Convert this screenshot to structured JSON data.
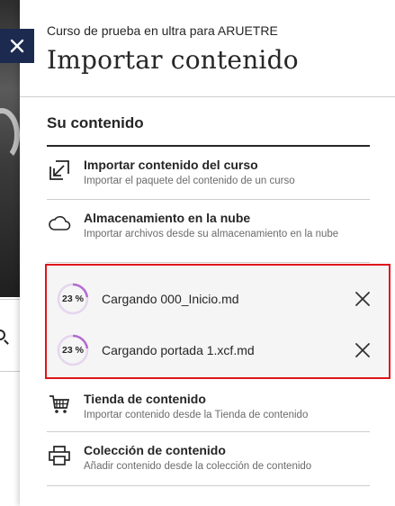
{
  "header": {
    "course_name": "Curso de prueba en ultra para ARUETRE",
    "title": "Importar contenido"
  },
  "section_title": "Su contenido",
  "items_top": [
    {
      "icon": "import-arrow-icon",
      "title": "Importar contenido del curso",
      "description": "Importar el paquete del contenido de un curso"
    },
    {
      "icon": "cloud-icon",
      "title": "Almacenamiento en la nube",
      "description": "Importar archivos desde su almacenamiento en la nube"
    }
  ],
  "uploads": [
    {
      "percent": "23 %",
      "progress": 0.23,
      "label": "Cargando 000_Inicio.md"
    },
    {
      "percent": "23 %",
      "progress": 0.23,
      "label": "Cargando portada 1.xcf.md"
    }
  ],
  "items_bottom": [
    {
      "icon": "cart-icon",
      "title": "Tienda de contenido",
      "description": "Importar contenido desde la Tienda de contenido"
    },
    {
      "icon": "printer-icon",
      "title": "Colección de contenido",
      "description": "Añadir contenido desde la colección de contenido"
    }
  ],
  "colors": {
    "close_bg": "#1b2a4e",
    "highlight_border": "#e0141b",
    "progress_ring": "#b36bd1",
    "progress_track": "#e6d6ee"
  }
}
